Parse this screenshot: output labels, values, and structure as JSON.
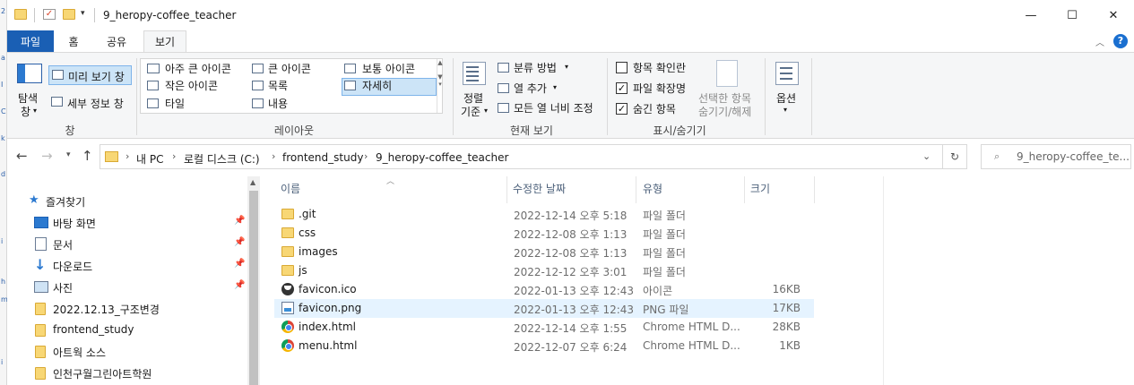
{
  "window": {
    "title": "9_heropy-coffee_teacher",
    "minimize": "—",
    "maximize": "☐",
    "close": "✕"
  },
  "ribbon_tabs": [
    "파일",
    "홈",
    "공유",
    "보기"
  ],
  "ribbon": {
    "pane": {
      "nav_pane_label": "탐색",
      "nav_pane_label2": "창",
      "preview_pane": "미리 보기 창",
      "details_pane": "세부 정보 창",
      "group_label": "창"
    },
    "layout": {
      "items": [
        "아주 큰 아이콘",
        "큰 아이콘",
        "보통 아이콘",
        "작은 아이콘",
        "목록",
        "자세히",
        "타일",
        "내용"
      ],
      "selected": "자세히",
      "group_label": "레이아웃"
    },
    "current_view": {
      "sort_by": "정렬",
      "sort_by2": "기준",
      "group_by": "분류 방법",
      "add_columns": "열 추가",
      "size_all_columns": "모든 열 너비 조정",
      "group_label": "현재 보기"
    },
    "show_hide": {
      "item_checkboxes": "항목 확인란",
      "item_checkboxes_checked": false,
      "file_extensions": "파일 확장명",
      "file_extensions_checked": true,
      "hidden_items": "숨긴 항목",
      "hidden_items_checked": true,
      "hide_selected": "선택한 항목",
      "hide_selected2": "숨기기/해제",
      "group_label": "표시/숨기기"
    },
    "options": {
      "label": "옵션"
    }
  },
  "address": {
    "crumbs": [
      "내 PC",
      "로컬 디스크 (C:)",
      "frontend_study",
      "9_heropy-coffee_teacher"
    ],
    "search_placeholder": "9_heropy-coffee_te..."
  },
  "nav_pane": {
    "quick_access": "즐겨찾기",
    "items": [
      {
        "label": "바탕 화면",
        "icon": "desktop-icon",
        "pinned": true
      },
      {
        "label": "문서",
        "icon": "document-icon",
        "pinned": true
      },
      {
        "label": "다운로드",
        "icon": "download-icon",
        "pinned": true
      },
      {
        "label": "사진",
        "icon": "pictures-icon",
        "pinned": true
      },
      {
        "label": "2022.12.13_구조변경",
        "icon": "folder-icon",
        "pinned": false
      },
      {
        "label": "frontend_study",
        "icon": "folder-icon",
        "pinned": false
      },
      {
        "label": "아트웍 소스",
        "icon": "folder-icon",
        "pinned": false
      },
      {
        "label": "인천구월그린아트학원",
        "icon": "folder-icon",
        "pinned": false
      }
    ]
  },
  "file_list": {
    "columns": [
      "이름",
      "수정한 날짜",
      "유형",
      "크기"
    ],
    "rows": [
      {
        "name": ".git",
        "date": "2022-12-14 오후 5:18",
        "type": "파일 폴더",
        "size": "",
        "icon": "folder"
      },
      {
        "name": "css",
        "date": "2022-12-08 오후 1:13",
        "type": "파일 폴더",
        "size": "",
        "icon": "folder"
      },
      {
        "name": "images",
        "date": "2022-12-08 오후 1:13",
        "type": "파일 폴더",
        "size": "",
        "icon": "folder"
      },
      {
        "name": "js",
        "date": "2022-12-12 오후 3:01",
        "type": "파일 폴더",
        "size": "",
        "icon": "folder"
      },
      {
        "name": "favicon.ico",
        "date": "2022-01-13 오후 12:43",
        "type": "아이콘",
        "size": "16KB",
        "icon": "ico"
      },
      {
        "name": "favicon.png",
        "date": "2022-01-13 오후 12:43",
        "type": "PNG 파일",
        "size": "17KB",
        "icon": "png"
      },
      {
        "name": "index.html",
        "date": "2022-12-14 오후 1:55",
        "type": "Chrome HTML D...",
        "size": "28KB",
        "icon": "chrome"
      },
      {
        "name": "menu.html",
        "date": "2022-12-07 오후 6:24",
        "type": "Chrome HTML D...",
        "size": "1KB",
        "icon": "chrome"
      }
    ],
    "selected_row": 5
  },
  "colors": {
    "file_tab": "#1a5fb4",
    "selection": "#e5f3ff",
    "folder": "#f8d775"
  }
}
